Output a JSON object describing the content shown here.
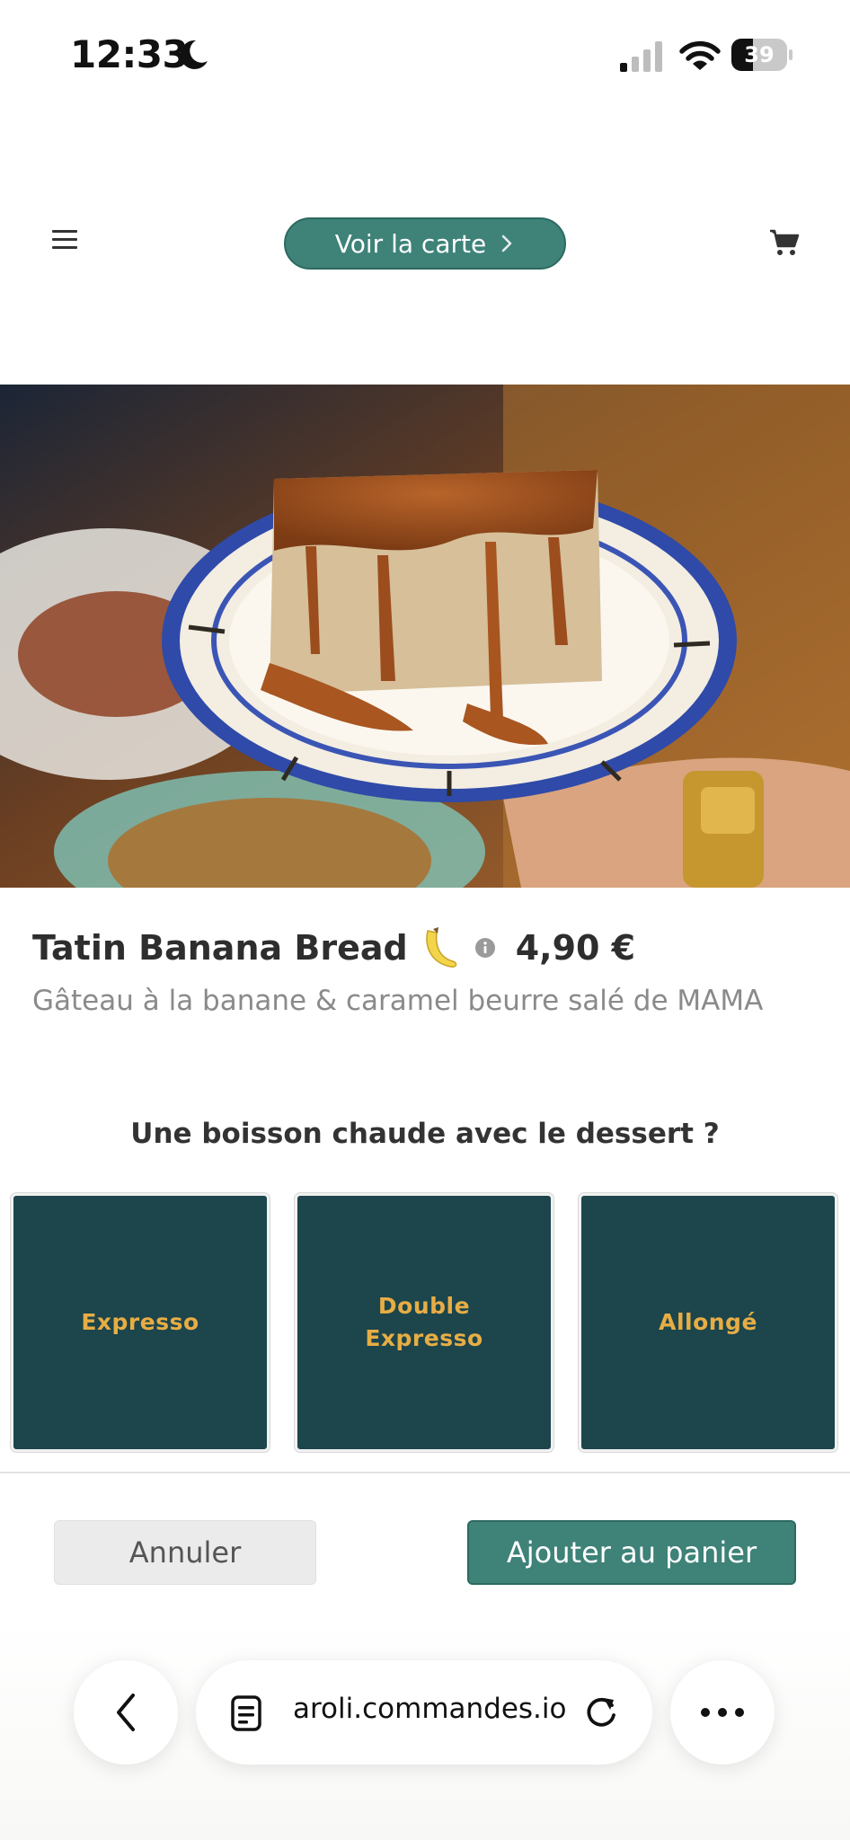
{
  "status_bar": {
    "time": "12:33",
    "battery_level": "39",
    "battery_fraction": 0.39
  },
  "header": {
    "menu_icon": "hamburger-menu-icon",
    "voir_label": "Voir la carte",
    "cart_icon": "cart-icon"
  },
  "hero": {
    "icon": "dessert-photo"
  },
  "product": {
    "name": "Tatin Banana Bread",
    "emoji_icon": "banana-icon",
    "price": "4,90 €",
    "description": "Gâteau à la banane & caramel beurre salé de MAMA"
  },
  "drink_section": {
    "question": "Une boisson chaude avec le dessert ?",
    "options": [
      {
        "label": "Expresso"
      },
      {
        "label": "Double Expresso"
      },
      {
        "label": "Allongé"
      }
    ]
  },
  "actions": {
    "cancel_label": "Annuler",
    "add_label": "Ajouter au panier"
  },
  "browser": {
    "url": "aroli.commandes.io"
  },
  "colors": {
    "accent_green": "#3e8278",
    "card_bg": "#1c454c",
    "card_text": "#e7ad44"
  }
}
